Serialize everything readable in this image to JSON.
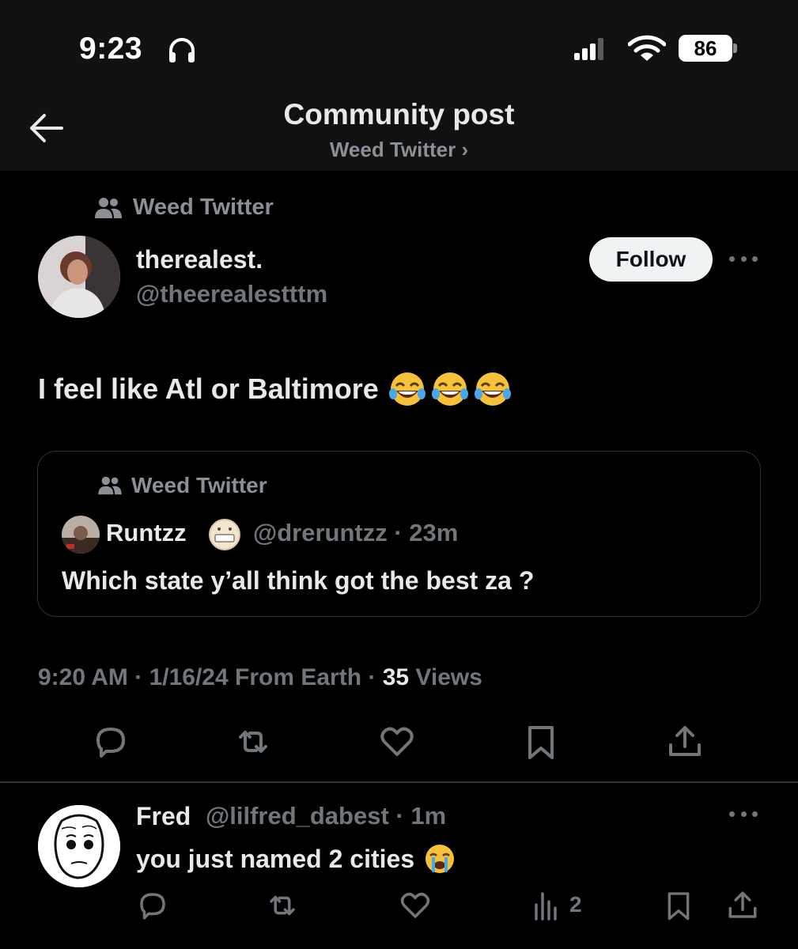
{
  "status_bar": {
    "time": "9:23",
    "battery": "86"
  },
  "header": {
    "title": "Community post",
    "subtitle": "Weed Twitter ›"
  },
  "post": {
    "community": "Weed Twitter",
    "author_name": "therealest.",
    "author_handle": "@theerealestttm",
    "follow_label": "Follow",
    "text": "I feel like Atl or Baltimore",
    "emojis": [
      "face-with-tears-of-joy",
      "face-with-tears-of-joy",
      "face-with-tears-of-joy"
    ],
    "quote": {
      "community": "Weed Twitter",
      "author_name": "Runtzz",
      "author_handle": "@dreruntzz · 23m",
      "text": "Which state y’all think got the best za ?"
    },
    "meta_time": "9:20 AM · 1/16/24 From Earth · ",
    "views_count": "35",
    "views_label": " Views",
    "actions": [
      "reply-icon",
      "retweet-icon",
      "like-icon",
      "bookmark-icon",
      "share-icon"
    ]
  },
  "reply": {
    "author_name": "Fred",
    "author_handle": "@lilfred_dabest · 1m",
    "text": "you just named 2 cities",
    "emoji": "loudly-crying-face",
    "views": "2",
    "actions": [
      "reply-icon",
      "retweet-icon",
      "like-icon",
      "views-icon",
      "bookmark-icon",
      "share-icon"
    ]
  },
  "colors": {
    "background": "#000000",
    "header_band": "#111112",
    "text_primary": "#e7e9ea",
    "text_secondary": "#71767b",
    "border": "#2f3336",
    "follow_button": "#eff3f4"
  }
}
